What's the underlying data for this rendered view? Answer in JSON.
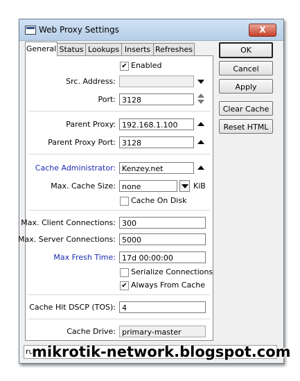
{
  "window": {
    "title": "Web Proxy Settings",
    "close_label": "X"
  },
  "tabs": [
    {
      "label": "General",
      "active": true
    },
    {
      "label": "Status"
    },
    {
      "label": "Lookups"
    },
    {
      "label": "Inserts"
    },
    {
      "label": "Refreshes"
    }
  ],
  "form": {
    "enabled": {
      "label": "Enabled",
      "checked": true
    },
    "src_address": {
      "label": "Src. Address:",
      "value": ""
    },
    "port": {
      "label": "Port:",
      "value": "3128"
    },
    "parent_proxy": {
      "label": "Parent Proxy:",
      "value": "192.168.1.100"
    },
    "parent_proxy_port": {
      "label": "Parent Proxy Port:",
      "value": "3128"
    },
    "cache_administrator": {
      "label": "Cache Administrator:",
      "value": "Kenzey.net"
    },
    "max_cache_size": {
      "label": "Max. Cache Size:",
      "value": "none",
      "unit": "KiB"
    },
    "cache_on_disk": {
      "label": "Cache On Disk",
      "checked": false
    },
    "max_client_connections": {
      "label": "Max. Client Connections:",
      "value": "300"
    },
    "max_server_connections": {
      "label": "Max. Server Connections:",
      "value": "5000"
    },
    "max_fresh_time": {
      "label": "Max Fresh Time:",
      "value": "17d 00:00:00"
    },
    "serialize_connections": {
      "label": "Serialize Connections",
      "checked": false
    },
    "always_from_cache": {
      "label": "Always From Cache",
      "checked": true
    },
    "cache_hit_dscp": {
      "label": "Cache Hit DSCP (TOS):",
      "value": "4"
    },
    "cache_drive": {
      "label": "Cache Drive:",
      "value": "primary-master"
    }
  },
  "buttons": {
    "ok": "OK",
    "cancel": "Cancel",
    "apply": "Apply",
    "clear_cache": "Clear Cache",
    "reset_html": "Reset HTML"
  },
  "status": {
    "text": "rur"
  },
  "watermark": "mikrotik-network.blogspot.com",
  "colors": {
    "link_label": "#1a2bb0",
    "title_bar": "#b7cfe8",
    "close_button": "#c7412b"
  }
}
